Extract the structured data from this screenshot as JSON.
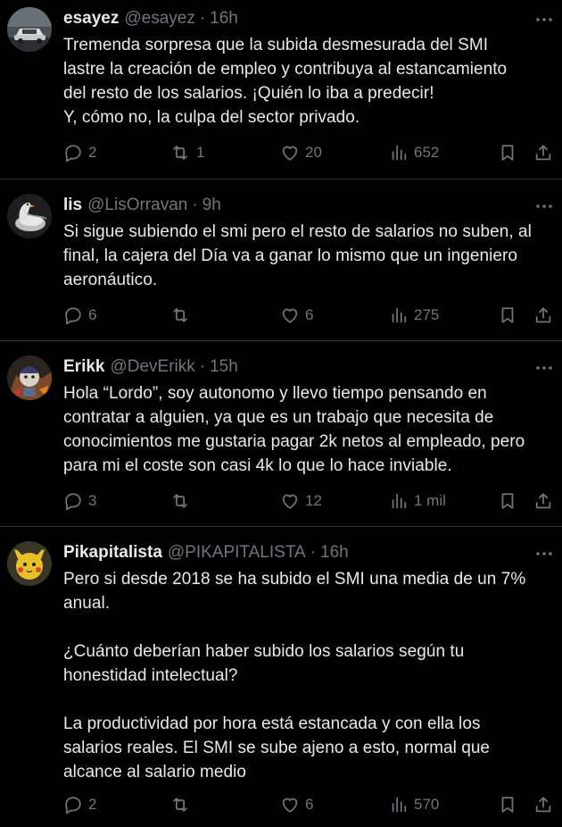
{
  "tweets": [
    {
      "name": "esayez",
      "handle": "@esayez",
      "sep": "·",
      "time": "16h",
      "text": "Tremenda sorpresa que la subida desmesurada del SMI\nlastre la creación de empleo y contribuya al estancamiento\ndel resto de los salarios. ¡Quién lo iba a predecir!\nY, cómo no, la culpa del sector privado.",
      "replies": "2",
      "retweets": "1",
      "likes": "20",
      "views": "652",
      "avatar_icon": "car-photo-avatar"
    },
    {
      "name": "lis",
      "handle": "@LisOrravan",
      "sep": "·",
      "time": "9h",
      "text": "Si sigue subiendo el smi pero el resto de salarios no suben, al\nfinal, la cajera del Día va a ganar lo mismo que un ingeniero\naeronáutico.",
      "replies": "6",
      "retweets": "",
      "likes": "6",
      "views": "275",
      "avatar_icon": "bird-photo-avatar"
    },
    {
      "name": "Erikk",
      "handle": "@DevErikk",
      "sep": "·",
      "time": "15h",
      "text": "Hola “Lordo”, soy autonomo y llevo tiempo pensando en\ncontratar a alguien, ya que es un trabajo que necesita de\nconocimientos me gustaria pagar 2k netos al empleado, pero\npara mi el coste son casi 4k lo que lo hace inviable.",
      "replies": "3",
      "retweets": "",
      "likes": "12",
      "views": "1 mil",
      "avatar_icon": "illustration-avatar"
    },
    {
      "name": "Pikapitalista",
      "handle": "@PIKAPITALISTA",
      "sep": "·",
      "time": "16h",
      "text": "Pero si desde 2018 se ha subido el SMI una media de un 7%\nanual.\n\n¿Cuánto deberían haber subido los salarios según tu\nhonestidad intelectual?\n\nLa productividad por hora está estancada y con ella los\nsalarios reales. El SMI se sube ajeno a esto, normal que\nalcance al salario medio",
      "replies": "2",
      "retweets": "",
      "likes": "6",
      "views": "570",
      "avatar_icon": "pikachu-avatar"
    }
  ],
  "colors": {
    "background": "#000000",
    "text": "#e7e9ea",
    "muted": "#71767b",
    "divider": "#2f3336"
  }
}
